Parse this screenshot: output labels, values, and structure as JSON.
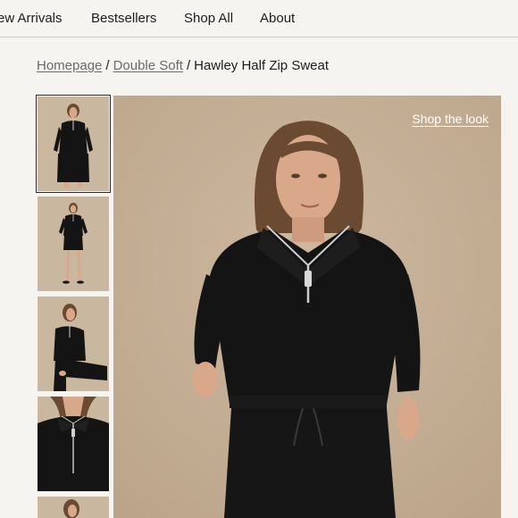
{
  "nav": {
    "items": [
      {
        "label": "ew Arrivals"
      },
      {
        "label": "Bestsellers"
      },
      {
        "label": "Shop All"
      },
      {
        "label": "About"
      }
    ]
  },
  "breadcrumb": {
    "home": "Homepage",
    "collection": "Double Soft",
    "separator": "/",
    "current": "Hawley Half Zip Sweat"
  },
  "gallery": {
    "shop_the_look": "Shop the look",
    "thumbnails": [
      "full-outfit-front",
      "full-outfit-standing",
      "seated",
      "zip-closeup",
      "partial"
    ],
    "colors": {
      "background": "#c7b49c",
      "garment": "#141414",
      "zip": "#cfcfcf",
      "skin": "#d9a88a",
      "hair": "#6b4a32"
    }
  }
}
